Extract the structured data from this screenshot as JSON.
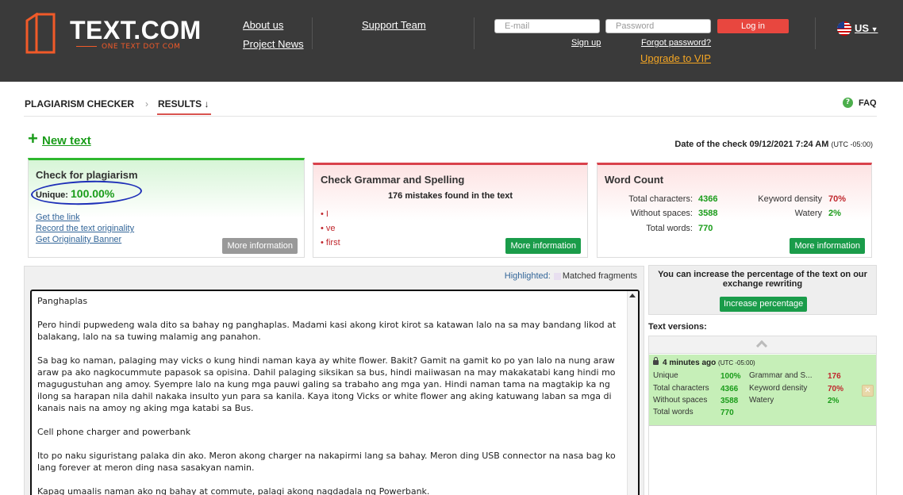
{
  "header": {
    "logo_text": "TEXT.COM",
    "logo_tagline": "ONE TEXT DOT COM",
    "nav": {
      "about": "About us",
      "news": "Project News",
      "support": "Support Team"
    },
    "login": {
      "email_placeholder": "E-mail",
      "password_placeholder": "Password",
      "login_label": "Log in",
      "signup": "Sign up",
      "forgot": "Forgot password?",
      "vip": "Upgrade to VIP"
    },
    "language": "US"
  },
  "breadcrumb": {
    "step1": "PLAGIARISM CHECKER",
    "step2": "RESULTS ↓",
    "faq": "FAQ"
  },
  "new_text": "New text",
  "date_check": {
    "label": "Date of the check 09/12/2021 7:24 AM",
    "tz": "(UTC -05:00)"
  },
  "plagiarism": {
    "title": "Check for plagiarism",
    "unique_label": "Unique:",
    "unique_value": "100.00%",
    "links": [
      "Get the link",
      "Record the text originality",
      "Get Originality Banner"
    ],
    "more": "More information"
  },
  "grammar": {
    "title": "Check Grammar and Spelling",
    "summary": "176 mistakes found in the text",
    "items": [
      "• I",
      "• ve",
      "• first"
    ],
    "more": "More information"
  },
  "wordcount": {
    "title": "Word Count",
    "total_chars_label": "Total characters:",
    "total_chars": "4366",
    "without_spaces_label": "Without spaces:",
    "without_spaces": "3588",
    "total_words_label": "Total words:",
    "total_words": "770",
    "keyword_density_label": "Keyword density",
    "keyword_density": "70%",
    "watery_label": "Watery",
    "watery": "2%",
    "more": "More information"
  },
  "legend": {
    "highlighted": "Highlighted:",
    "matched": "Matched fragments"
  },
  "text_paragraphs": [
    "Panghaplas",
    "Pero hindi pupwedeng wala dito sa bahay ng panghaplas.  Madami kasi akong kirot kirot sa katawan lalo na sa may bandang likod at balakang, lalo na sa tuwing malamig ang panahon.",
    "Sa bag ko naman, palaging may vicks o kung hindi naman kaya ay white flower. Bakit? Gamit na gamit ko po yan lalo na nung araw araw pa ako nagkocummute papasok sa opisina. Dahil palaging siksikan sa bus, hindi maiiwasan na may makakatabi kang hindi mo magugustuhan ang amoy. Syempre lalo na kung mga pauwi galing sa trabaho ang mga yan. Hindi naman tama na magtakip ka ng ilong sa harapan nila dahil nakaka insulto yun para sa kanila. Kaya itong Vicks or white flower ang aking katuwang laban sa mga di kanais nais na amoy ng aking mga katabi sa Bus.",
    "Cell phone charger and powerbank",
    "Ito po naku siguristang palaka din ako. Meron akong charger na nakapirmi lang sa bahay. Meron ding USB connector na nasa bag ko lang forever at meron ding nasa sasakyan namin.",
    "Kapag umaalis naman ako ng bahay at commute, palagi akong nagdadala ng Powerbank."
  ],
  "increase": {
    "text": "You can increase the percentage of the text on our exchange rewriting",
    "button": "Increase percentage"
  },
  "versions": {
    "label": "Text versions:",
    "item": {
      "time": "4 minutes ago",
      "tz": "(UTC -05:00)",
      "unique_label": "Unique",
      "unique": "100%",
      "total_chars_label": "Total characters",
      "total_chars": "4366",
      "without_spaces_label": "Without spaces",
      "without_spaces": "3588",
      "total_words_label": "Total words",
      "total_words": "770",
      "grammar_label": "Grammar and S...",
      "grammar": "176",
      "keyword_label": "Keyword density",
      "keyword": "70%",
      "watery_label": "Watery",
      "watery": "2%"
    }
  }
}
